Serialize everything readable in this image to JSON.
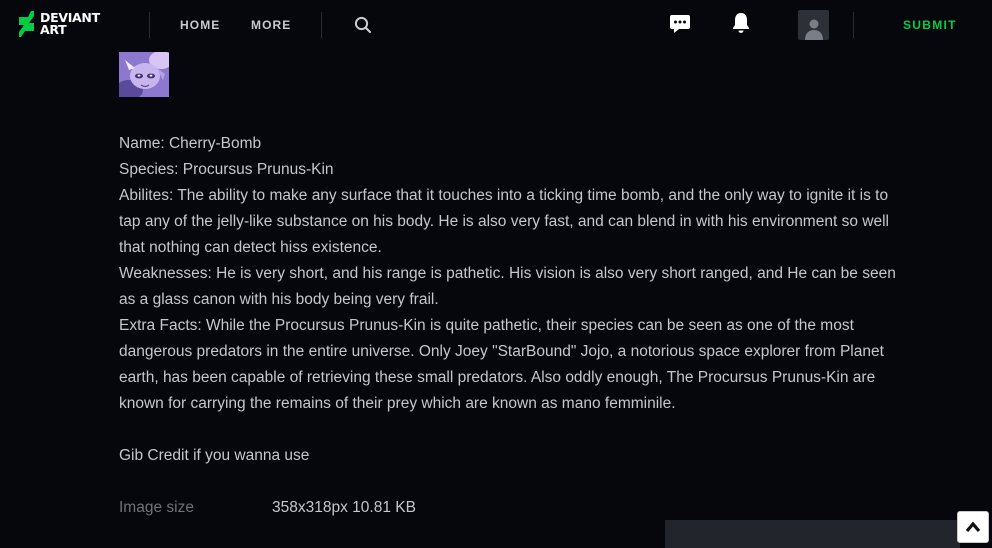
{
  "header": {
    "logo_line1": "DEVIANT",
    "logo_line2": "ART",
    "nav": {
      "home": "HOME",
      "more": "MORE"
    },
    "submit": "SUBMIT",
    "icons": [
      "search-icon",
      "chat-icon",
      "bell-icon",
      "user-avatar-icon"
    ],
    "accent_color": "#05cc47"
  },
  "description": {
    "lines": [
      "Name: Cherry-Bomb",
      "Species: Procursus Prunus-Kin",
      "Abilites: The ability to make any surface that it touches into a ticking time bomb, and the only way to ignite it is to tap any of the jelly-like substance on his body. He is also very fast, and can blend in with his environment so well that nothing can detect hiss existence.",
      "Weaknesses: He is very short, and his range is pathetic. His vision is also very short ranged, and He can be seen as a glass canon with his body being very frail.",
      "Extra Facts: While the Procursus Prunus-Kin is quite pathetic, their species can be seen as one of the most dangerous predators in the entire universe. Only Joey \"StarBound\" Jojo, a notorious space explorer from Planet earth, has been capable of retrieving these small predators. Also oddly enough, The Procursus Prunus-Kin are known for carrying the remains of their prey which are known as mano femminile.",
      "Gib Credit if you wanna use"
    ]
  },
  "meta": {
    "image_size_label": "Image size",
    "image_size_value": "358x318px 10.81 KB"
  },
  "widgets": {
    "scroll_top_icon": "chevron-up-icon"
  }
}
